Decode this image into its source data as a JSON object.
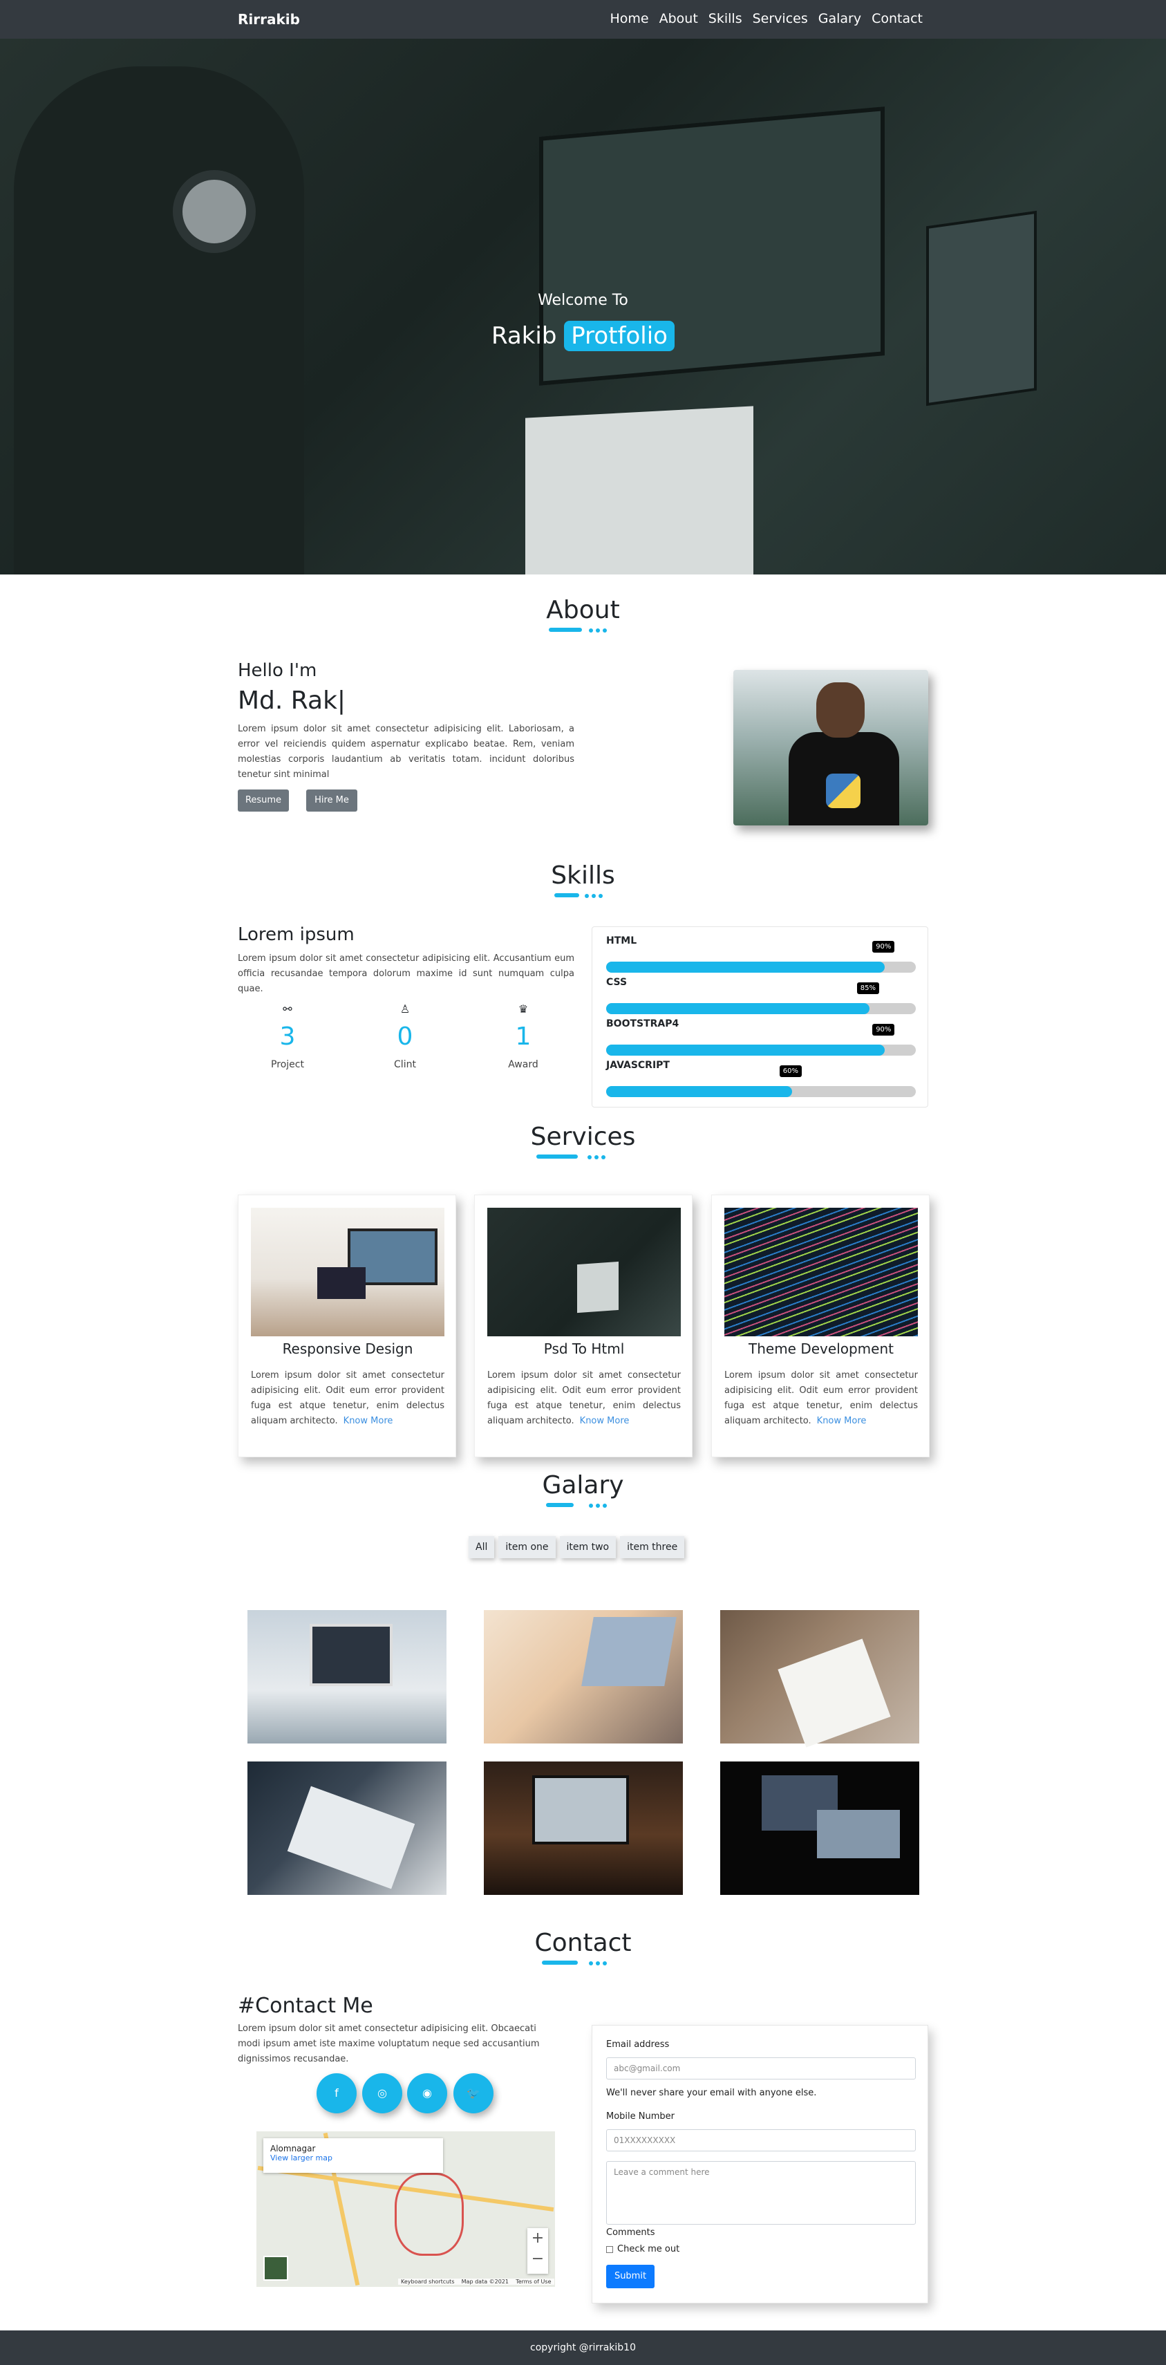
{
  "nav": {
    "brand": "Rirrakib",
    "items": [
      "Home",
      "About",
      "Skills",
      "Services",
      "Galary",
      "Contact"
    ]
  },
  "hero": {
    "welcome": "Welcome To",
    "name": "Rakib",
    "highlight": "Protfolio"
  },
  "about": {
    "title": "About",
    "hello": "Hello I'm",
    "name": "Md. Rak|",
    "text": "Lorem ipsum dolor sit amet consectetur adipisicing elit. Laboriosam, a error vel reiciendis quidem aspernatur explicabo beatae. Rem, veniam molestias corporis laudantium ab veritatis totam. incidunt doloribus tenetur sint minimal",
    "btn_resume": "Resume",
    "btn_hire": "Hire Me"
  },
  "skills": {
    "title": "Skills",
    "left_title": "Lorem ipsum",
    "left_text": "Lorem ipsum dolor sit amet consectetur adipisicing elit. Accusantium eum officia recusandae tempora dolorum maxime id sunt numquam culpa quae.",
    "stats": [
      {
        "icon": "⚯",
        "value": "3",
        "label": "Project"
      },
      {
        "icon": "♙",
        "value": "0",
        "label": "Clint"
      },
      {
        "icon": "♛",
        "value": "1",
        "label": "Award"
      }
    ],
    "bars": [
      {
        "name": "HTML",
        "percent": 90,
        "label": "90%"
      },
      {
        "name": "CSS",
        "percent": 85,
        "label": "85%"
      },
      {
        "name": "BOOTSTRAP4",
        "percent": 90,
        "label": "90%"
      },
      {
        "name": "JAVASCRIPT",
        "percent": 60,
        "label": "60%"
      }
    ]
  },
  "services": {
    "title": "Services",
    "cards": [
      {
        "title": "Responsive Design",
        "text": "Lorem ipsum dolor sit amet consectetur adipisicing elit. Odit eum error provident fuga est atque tenetur, enim delectus aliquam architecto.",
        "link": "Know More"
      },
      {
        "title": "Psd To Html",
        "text": "Lorem ipsum dolor sit amet consectetur adipisicing elit. Odit eum error provident fuga est atque tenetur, enim delectus aliquam architecto.",
        "link": "Know More"
      },
      {
        "title": "Theme Development",
        "text": "Lorem ipsum dolor sit amet consectetur adipisicing elit. Odit eum error provident fuga est atque tenetur, enim delectus aliquam architecto.",
        "link": "Know More"
      }
    ]
  },
  "gallery": {
    "title": "Galary",
    "filters": [
      "All",
      "item one",
      "item two",
      "item three"
    ]
  },
  "contact": {
    "title": "Contact",
    "heading": "#Contact Me",
    "text": "Lorem ipsum dolor sit amet consectetur adipisicing elit. Obcaecati modi ipsum amet iste maxime voluptatum neque sed accusantium dignissimos recusandae.",
    "socials": [
      "f",
      "◎",
      "◉",
      "🐦"
    ],
    "map": {
      "place": "Alomnagar",
      "link": "View larger map",
      "attrib1": "Keyboard shortcuts",
      "attrib2": "Map data ©2021",
      "attrib3": "Terms of Use"
    },
    "form": {
      "email_label": "Email address",
      "email_placeholder": "abc@gmail.com",
      "email_help": "We'll never share your email with anyone else.",
      "mobile_label": "Mobile Number",
      "mobile_placeholder": "01XXXXXXXXX",
      "comment_placeholder": "Leave a comment here",
      "comment_label": "Comments",
      "check_label": "Check me out",
      "submit": "Submit"
    }
  },
  "footer": {
    "text": "copyright   @rirrakib10"
  }
}
